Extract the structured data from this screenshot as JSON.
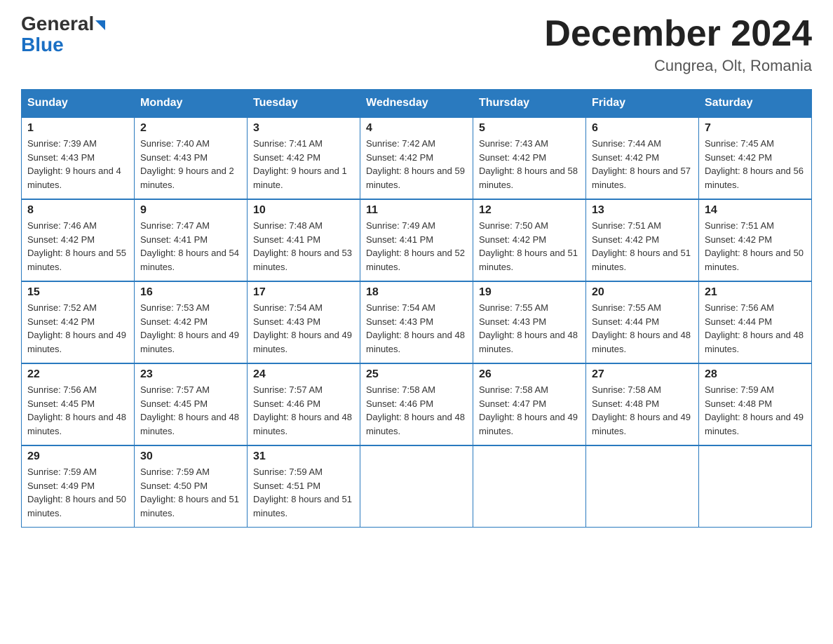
{
  "header": {
    "logo_general": "General",
    "logo_blue": "Blue",
    "month_title": "December 2024",
    "location": "Cungrea, Olt, Romania"
  },
  "weekdays": [
    "Sunday",
    "Monday",
    "Tuesday",
    "Wednesday",
    "Thursday",
    "Friday",
    "Saturday"
  ],
  "weeks": [
    [
      {
        "day": "1",
        "sunrise": "7:39 AM",
        "sunset": "4:43 PM",
        "daylight": "9 hours and 4 minutes."
      },
      {
        "day": "2",
        "sunrise": "7:40 AM",
        "sunset": "4:43 PM",
        "daylight": "9 hours and 2 minutes."
      },
      {
        "day": "3",
        "sunrise": "7:41 AM",
        "sunset": "4:42 PM",
        "daylight": "9 hours and 1 minute."
      },
      {
        "day": "4",
        "sunrise": "7:42 AM",
        "sunset": "4:42 PM",
        "daylight": "8 hours and 59 minutes."
      },
      {
        "day": "5",
        "sunrise": "7:43 AM",
        "sunset": "4:42 PM",
        "daylight": "8 hours and 58 minutes."
      },
      {
        "day": "6",
        "sunrise": "7:44 AM",
        "sunset": "4:42 PM",
        "daylight": "8 hours and 57 minutes."
      },
      {
        "day": "7",
        "sunrise": "7:45 AM",
        "sunset": "4:42 PM",
        "daylight": "8 hours and 56 minutes."
      }
    ],
    [
      {
        "day": "8",
        "sunrise": "7:46 AM",
        "sunset": "4:42 PM",
        "daylight": "8 hours and 55 minutes."
      },
      {
        "day": "9",
        "sunrise": "7:47 AM",
        "sunset": "4:41 PM",
        "daylight": "8 hours and 54 minutes."
      },
      {
        "day": "10",
        "sunrise": "7:48 AM",
        "sunset": "4:41 PM",
        "daylight": "8 hours and 53 minutes."
      },
      {
        "day": "11",
        "sunrise": "7:49 AM",
        "sunset": "4:41 PM",
        "daylight": "8 hours and 52 minutes."
      },
      {
        "day": "12",
        "sunrise": "7:50 AM",
        "sunset": "4:42 PM",
        "daylight": "8 hours and 51 minutes."
      },
      {
        "day": "13",
        "sunrise": "7:51 AM",
        "sunset": "4:42 PM",
        "daylight": "8 hours and 51 minutes."
      },
      {
        "day": "14",
        "sunrise": "7:51 AM",
        "sunset": "4:42 PM",
        "daylight": "8 hours and 50 minutes."
      }
    ],
    [
      {
        "day": "15",
        "sunrise": "7:52 AM",
        "sunset": "4:42 PM",
        "daylight": "8 hours and 49 minutes."
      },
      {
        "day": "16",
        "sunrise": "7:53 AM",
        "sunset": "4:42 PM",
        "daylight": "8 hours and 49 minutes."
      },
      {
        "day": "17",
        "sunrise": "7:54 AM",
        "sunset": "4:43 PM",
        "daylight": "8 hours and 49 minutes."
      },
      {
        "day": "18",
        "sunrise": "7:54 AM",
        "sunset": "4:43 PM",
        "daylight": "8 hours and 48 minutes."
      },
      {
        "day": "19",
        "sunrise": "7:55 AM",
        "sunset": "4:43 PM",
        "daylight": "8 hours and 48 minutes."
      },
      {
        "day": "20",
        "sunrise": "7:55 AM",
        "sunset": "4:44 PM",
        "daylight": "8 hours and 48 minutes."
      },
      {
        "day": "21",
        "sunrise": "7:56 AM",
        "sunset": "4:44 PM",
        "daylight": "8 hours and 48 minutes."
      }
    ],
    [
      {
        "day": "22",
        "sunrise": "7:56 AM",
        "sunset": "4:45 PM",
        "daylight": "8 hours and 48 minutes."
      },
      {
        "day": "23",
        "sunrise": "7:57 AM",
        "sunset": "4:45 PM",
        "daylight": "8 hours and 48 minutes."
      },
      {
        "day": "24",
        "sunrise": "7:57 AM",
        "sunset": "4:46 PM",
        "daylight": "8 hours and 48 minutes."
      },
      {
        "day": "25",
        "sunrise": "7:58 AM",
        "sunset": "4:46 PM",
        "daylight": "8 hours and 48 minutes."
      },
      {
        "day": "26",
        "sunrise": "7:58 AM",
        "sunset": "4:47 PM",
        "daylight": "8 hours and 49 minutes."
      },
      {
        "day": "27",
        "sunrise": "7:58 AM",
        "sunset": "4:48 PM",
        "daylight": "8 hours and 49 minutes."
      },
      {
        "day": "28",
        "sunrise": "7:59 AM",
        "sunset": "4:48 PM",
        "daylight": "8 hours and 49 minutes."
      }
    ],
    [
      {
        "day": "29",
        "sunrise": "7:59 AM",
        "sunset": "4:49 PM",
        "daylight": "8 hours and 50 minutes."
      },
      {
        "day": "30",
        "sunrise": "7:59 AM",
        "sunset": "4:50 PM",
        "daylight": "8 hours and 51 minutes."
      },
      {
        "day": "31",
        "sunrise": "7:59 AM",
        "sunset": "4:51 PM",
        "daylight": "8 hours and 51 minutes."
      },
      null,
      null,
      null,
      null
    ]
  ]
}
